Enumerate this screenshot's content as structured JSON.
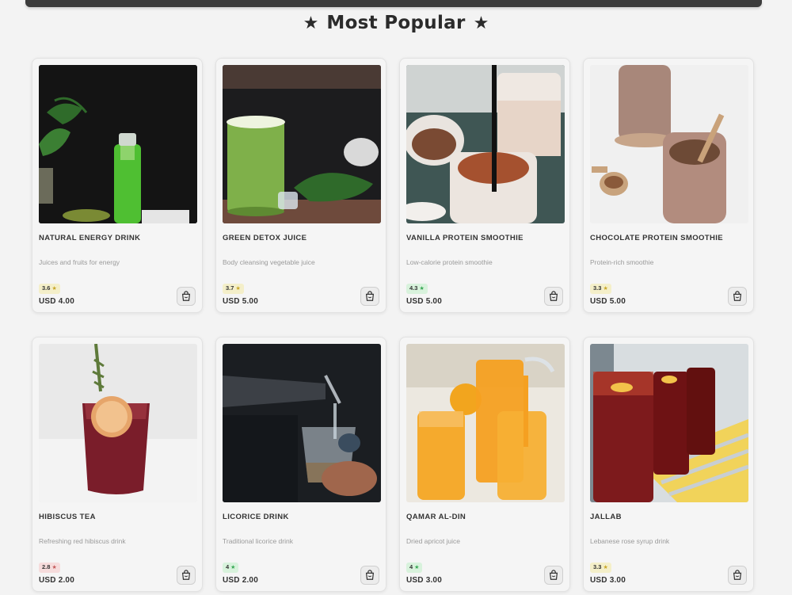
{
  "section": {
    "title": "Most Popular",
    "icon": "star-icon"
  },
  "rating_colors": {
    "high": "#d8f2dc",
    "mid": "#f4efc9",
    "low": "#f6dcdc",
    "star_high": "#3aa856",
    "star_mid": "#c9a72a",
    "star_low": "#c45b5b"
  },
  "products": [
    {
      "name": "NATURAL ENERGY DRINK",
      "description": "Juices and fruits for energy",
      "rating": "3.6",
      "rating_level": "mid",
      "price": "USD 4.00",
      "image": "green-juice-bottle"
    },
    {
      "name": "GREEN DETOX JUICE",
      "description": "Body cleansing vegetable juice",
      "rating": "3.7",
      "rating_level": "mid",
      "price": "USD 5.00",
      "image": "green-smoothie-glass"
    },
    {
      "name": "VANILLA PROTEIN SMOOTHIE",
      "description": "Low-calorie protein smoothie",
      "rating": "4.3",
      "rating_level": "high",
      "price": "USD 5.00",
      "image": "vanilla-smoothie-jars"
    },
    {
      "name": "CHOCOLATE PROTEIN SMOOTHIE",
      "description": "Protein-rich smoothie",
      "rating": "3.3",
      "rating_level": "mid",
      "price": "USD 5.00",
      "image": "chocolate-smoothie-jars"
    },
    {
      "name": "HIBISCUS TEA",
      "description": "Refreshing red hibiscus drink",
      "rating": "2.8",
      "rating_level": "low",
      "price": "USD 2.00",
      "image": "hibiscus-glass"
    },
    {
      "name": "LICORICE DRINK",
      "description": "Traditional licorice drink",
      "rating": "4",
      "rating_level": "high",
      "price": "USD 2.00",
      "image": "licorice-pour"
    },
    {
      "name": "QAMAR AL-DIN",
      "description": "Dried apricot juice",
      "rating": "4",
      "rating_level": "high",
      "price": "USD 3.00",
      "image": "apricot-jugs"
    },
    {
      "name": "JALLAB",
      "description": "Lebanese rose syrup drink",
      "rating": "3.3",
      "rating_level": "mid",
      "price": "USD 3.00",
      "image": "jallab-glasses"
    }
  ]
}
